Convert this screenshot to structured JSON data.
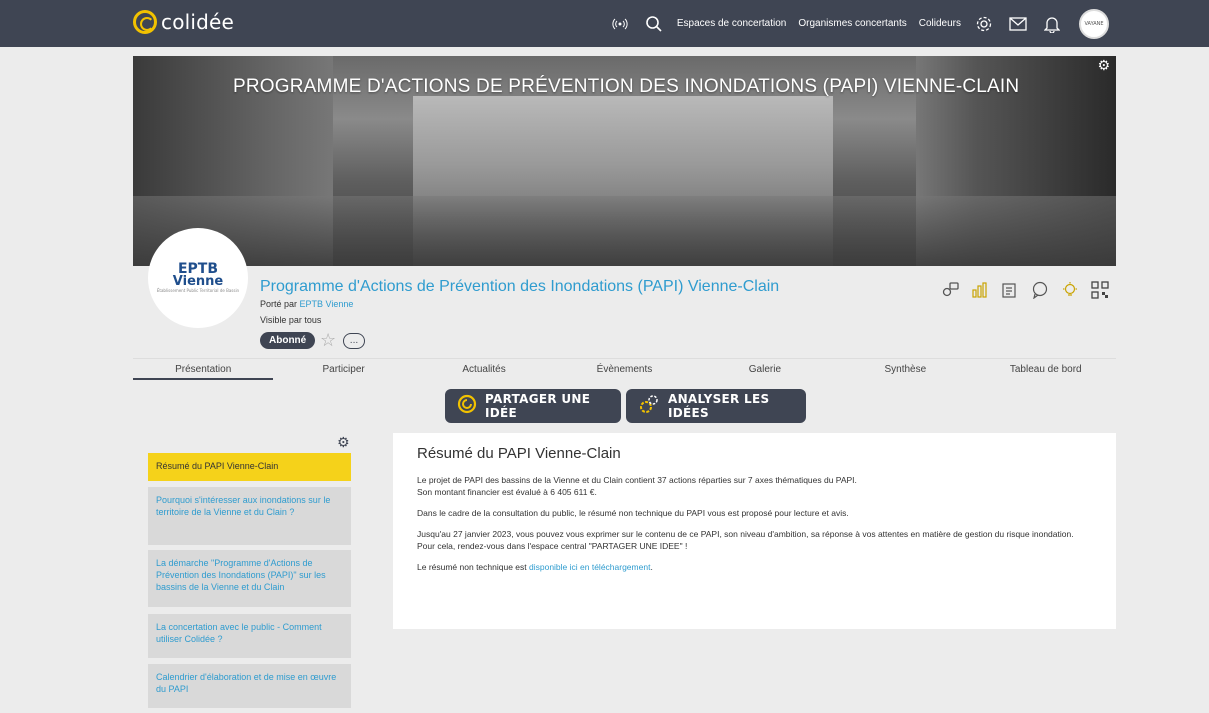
{
  "brand": {
    "name": "colidée"
  },
  "nav": {
    "links": [
      "Espaces de concertation",
      "Organismes concertants",
      "Colideurs"
    ],
    "avatar_text": "VAYANE"
  },
  "banner": {
    "title": "PROGRAMME D'ACTIONS DE PRÉVENTION DES INONDATIONS (PAPI) VIENNE-CLAIN"
  },
  "org": {
    "logo_line1": "EPTB",
    "logo_line2": "Vienne",
    "logo_small": "Établissement Public Territorial de Bassin"
  },
  "project": {
    "title": "Programme d'Actions de Prévention des Inondations (PAPI) Vienne-Clain",
    "porte_prefix": "Porté par ",
    "porte_org": "EPTB Vienne",
    "visibility": "Visible par tous",
    "subscribed_label": "Abonné",
    "more_label": "..."
  },
  "tabs": [
    "Présentation",
    "Participer",
    "Actualités",
    "Évènements",
    "Galerie",
    "Synthèse",
    "Tableau de bord"
  ],
  "actions": {
    "share": "PARTAGER UNE IDÉE",
    "analyze": "ANALYSER LES IDÉES"
  },
  "sidebar": {
    "items": [
      "Résumé du PAPI Vienne-Clain",
      "Pourquoi s'intéresser aux inondations sur le territoire de la Vienne et du Clain ?",
      "La démarche \"Programme d'Actions de Prévention des Inondations (PAPI)\" sur les bassins de la Vienne et du Clain",
      "La concertation avec le public - Comment utiliser Colidée ?",
      "Calendrier d'élaboration et de mise en œuvre du PAPI"
    ]
  },
  "content": {
    "heading": "Résumé du PAPI Vienne-Clain",
    "p1": "Le projet de PAPI des bassins de la Vienne et du Clain contient 37 actions réparties sur 7 axes thématiques du PAPI.",
    "p1b": "Son montant financier est évalué à 6 405 611 €.",
    "p2": "Dans le cadre de la consultation du public, le résumé non technique du PAPI vous est proposé pour lecture et avis.",
    "p3": "Jusqu'au 27 janvier 2023, vous pouvez vous exprimer sur le contenu de ce PAPI, son niveau d'ambition, sa réponse à vos attentes en matière de gestion du risque inondation. Pour cela, rendez-vous dans l'espace central \"PARTAGER UNE IDEE\" !",
    "p4_prefix": "Le résumé non technique est ",
    "p4_link": "disponible ici en téléchargement",
    "p4_suffix": "."
  },
  "colors": {
    "topbar": "#3f4553",
    "accent_yellow": "#f5d21a",
    "link_blue": "#2f9ccf",
    "sidebar_gray": "#d9d9d9"
  }
}
